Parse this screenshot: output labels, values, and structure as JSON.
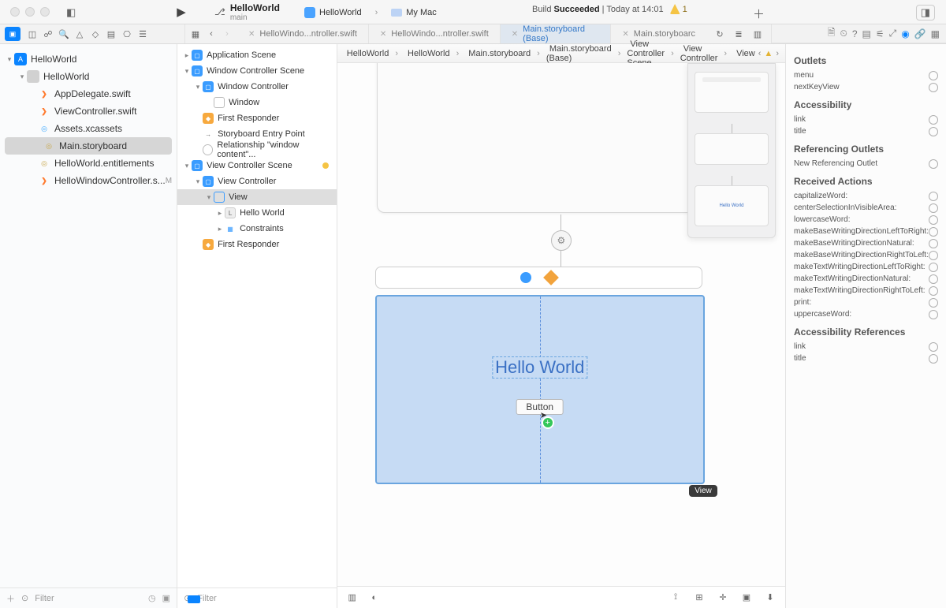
{
  "window": {
    "project_name": "HelloWorld",
    "branch": "main",
    "scheme_app": "HelloWorld",
    "scheme_dest": "My Mac",
    "build_prefix": "Build",
    "build_status": "Succeeded",
    "build_time_sep": " | ",
    "build_time": "Today at 14:01",
    "warning_count": "1"
  },
  "tabs": [
    {
      "label": "HelloWindo...ntroller.swift",
      "active": false
    },
    {
      "label": "HelloWindo...ntroller.swift",
      "active": false
    },
    {
      "label": "Main.storyboard (Base)",
      "active": true
    },
    {
      "label": "Main.storyboarc",
      "active": false
    }
  ],
  "navigator": {
    "project": "HelloWorld",
    "group": "HelloWorld",
    "files": [
      {
        "name": "AppDelegate.swift",
        "icon": "swift"
      },
      {
        "name": "ViewController.swift",
        "icon": "swift"
      },
      {
        "name": "Assets.xcassets",
        "icon": "assets"
      },
      {
        "name": "Main.storyboard",
        "icon": "story",
        "selected": true
      },
      {
        "name": "HelloWorld.entitlements",
        "icon": "ent"
      },
      {
        "name": "HelloWindowController.s...",
        "icon": "swift",
        "badge": "M"
      }
    ],
    "filter_placeholder": "Filter"
  },
  "outline": {
    "app_scene": "Application Scene",
    "win_scene": "Window Controller Scene",
    "win_ctrl": "Window Controller",
    "window": "Window",
    "first_resp": "First Responder",
    "entry": "Storyboard Entry Point",
    "relationship": "Relationship \"window content\"...",
    "vc_scene": "View Controller Scene",
    "vc": "View Controller",
    "view": "View",
    "hw": "Hello World",
    "constraints": "Constraints",
    "filter_placeholder": "Filter"
  },
  "breadcrumb": [
    "HelloWorld",
    "HelloWorld",
    "Main.storyboard",
    "Main.storyboard (Base)",
    "View Controller Scene",
    "View Controller",
    "View"
  ],
  "canvas": {
    "label_text": "Hello World",
    "button_text": "Button",
    "view_badge": "View",
    "minimap_label": "Hello World"
  },
  "inspector": {
    "sec_outlets": "Outlets",
    "outlets": [
      "menu",
      "nextKeyView"
    ],
    "sec_access": "Accessibility",
    "access": [
      "link",
      "title"
    ],
    "sec_ref": "Referencing Outlets",
    "ref": [
      "New Referencing Outlet"
    ],
    "sec_recv": "Received Actions",
    "actions": [
      "capitalizeWord:",
      "centerSelectionInVisibleArea:",
      "lowercaseWord:",
      "makeBaseWritingDirectionLeftToRight:",
      "makeBaseWritingDirectionNatural:",
      "makeBaseWritingDirectionRightToLeft:",
      "makeTextWritingDirectionLeftToRight:",
      "makeTextWritingDirectionNatural:",
      "makeTextWritingDirectionRightToLeft:",
      "print:",
      "uppercaseWord:"
    ],
    "sec_accref": "Accessibility References",
    "accref": [
      "link",
      "title"
    ]
  }
}
